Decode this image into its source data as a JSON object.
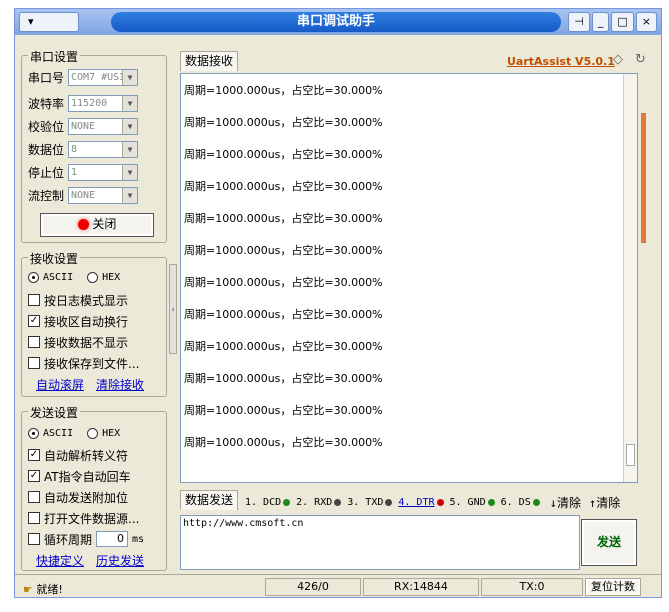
{
  "window": {
    "title": "串口调试助手",
    "sysmenu_label": "▾",
    "pin_label": "⊣",
    "minimize_label": "_",
    "maximize_label": "□",
    "close_label": "×"
  },
  "serial_settings": {
    "title": "串口设置",
    "fields": [
      {
        "label": "串口号",
        "value": "COM7 #USI"
      },
      {
        "label": "波特率",
        "value": "115200"
      },
      {
        "label": "校验位",
        "value": "NONE"
      },
      {
        "label": "数据位",
        "value": "8"
      },
      {
        "label": "停止位",
        "value": "1"
      },
      {
        "label": "流控制",
        "value": "NONE"
      }
    ],
    "close_button": "关闭"
  },
  "recv_settings": {
    "title": "接收设置",
    "ascii": "ASCII",
    "hex": "HEX",
    "options": [
      {
        "label": "按日志模式显示",
        "checked": false
      },
      {
        "label": "接收区自动换行",
        "checked": true
      },
      {
        "label": "接收数据不显示",
        "checked": false
      },
      {
        "label": "接收保存到文件...",
        "checked": false
      }
    ],
    "auto_clear": "自动滚屏",
    "clear_recv": "清除接收"
  },
  "send_settings": {
    "title": "发送设置",
    "ascii": "ASCII",
    "hex": "HEX",
    "options": [
      {
        "label": "自动解析转义符",
        "checked": true
      },
      {
        "label": "AT指令自动回车",
        "checked": true
      },
      {
        "label": "自动发送附加位",
        "checked": false
      },
      {
        "label": "打开文件数据源...",
        "checked": false
      }
    ],
    "loop_label": "循环周期",
    "loop_value": "0",
    "loop_unit": "ms",
    "shortcut": "快捷定义",
    "history": "历史发送"
  },
  "recv_area": {
    "tab": "数据接收",
    "brand": "UartAssist V5.0.1",
    "lines": [
      "周期=1000.000us，占空比=30.000%",
      "周期=1000.000us，占空比=30.000%",
      "周期=1000.000us，占空比=30.000%",
      "周期=1000.000us，占空比=30.000%",
      "周期=1000.000us，占空比=30.000%",
      "周期=1000.000us，占空比=30.000%",
      "周期=1000.000us，占空比=30.000%",
      "周期=1000.000us，占空比=30.000%",
      "周期=1000.000us，占空比=30.000%",
      "周期=1000.000us，占空比=30.000%",
      "周期=1000.000us，占空比=30.000%",
      "周期=1000.000us，占空比=30.000%"
    ]
  },
  "send_area": {
    "tab": "数据发送",
    "signals": [
      {
        "label": "1. DCD",
        "color": "#1a8a1a"
      },
      {
        "label": "2. RXD",
        "color": "#444444"
      },
      {
        "label": "3. TXD",
        "color": "#444444"
      },
      {
        "label": "4. DTR",
        "color": "#cc0000"
      },
      {
        "label": "5. GND",
        "color": "#1a8a1a"
      },
      {
        "label": "6. DS",
        "color": "#1a8a1a"
      }
    ],
    "clear1": "清除",
    "clear2": "清除",
    "input_value": "http://www.cmsoft.cn",
    "send_button": "发送"
  },
  "status": {
    "ready": "就绪!",
    "count": "426/0",
    "rx": "RX:14844",
    "tx": "TX:0",
    "reset": "复位计数"
  }
}
